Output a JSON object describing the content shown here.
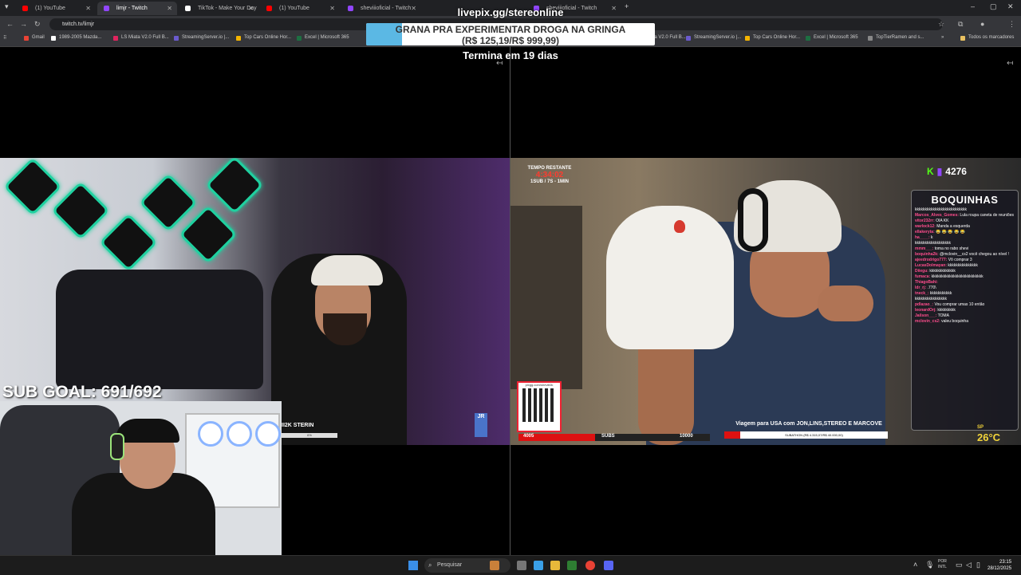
{
  "browser": {
    "tabs": [
      {
        "title": "(1) YouTube",
        "color": "#ff0000",
        "active": false
      },
      {
        "title": "limjr - Twitch",
        "color": "#9146ff",
        "active": true
      },
      {
        "title": "TikTok - Make Your Day",
        "color": "#ffffff",
        "active": false
      },
      {
        "title": "(1) YouTube",
        "color": "#ff0000",
        "active": false
      },
      {
        "title": "sheviiioficial - Twitch",
        "color": "#9146ff",
        "active": false
      },
      {
        "title": "sheviiioficial - Twitch",
        "color": "#9146ff",
        "active": false
      }
    ],
    "new_tab": "+",
    "url": "twitch.tv/limjr",
    "bookmarks": [
      {
        "label": "Gmail",
        "color": "#ea4335"
      },
      {
        "label": "1989-2005 Mazda...",
        "color": "#ffffff"
      },
      {
        "label": "LS Miata V2.0 Full B...",
        "color": "#e0245e"
      },
      {
        "label": "StreamingServer.io |...",
        "color": "#6a5acd"
      },
      {
        "label": "Top Cars Online Hor...",
        "color": "#f4b400"
      },
      {
        "label": "Excel | Microsoft 365",
        "color": "#1d6f42"
      },
      {
        "label": "LS Miata V2.0 Full B...",
        "color": "#e0245e"
      },
      {
        "label": "StreamingServer.io |...",
        "color": "#6a5acd"
      },
      {
        "label": "Top Cars Online Hor...",
        "color": "#f4b400"
      },
      {
        "label": "Excel | Microsoft 365",
        "color": "#1d6f42"
      },
      {
        "label": "TopTierRamen and s...",
        "color": "#888888"
      }
    ],
    "all_bookmarks": "Todos os marcadores"
  },
  "overlay": {
    "site": "livepix.gg/stereonline",
    "promo_line1": "GRANA PRA EXPERIMENTAR DROGA NA GRINGA",
    "promo_line2": "(R$ 125,19/R$ 999,99)",
    "promo_progress": 0.125,
    "timer": "Termina em 19 dias"
  },
  "left_stream": {
    "sub_goal": "SUB GOAL: 691/692",
    "tag": "II2K STERIN",
    "tag_pct": "6%",
    "logo": "JR"
  },
  "right_stream": {
    "timer_label": "TEMPO RESTANTE",
    "timer_value": "4:34:02",
    "timer_rule": "1SUB / 7S - 1MIN",
    "viewers": "4276",
    "chat_title": "BOQUINHAS",
    "chat": [
      {
        "user": "",
        "msg": "kkkkkkkkkkkkkkkkkkkkkkkkkk"
      },
      {
        "user": "Marcos_Alves_Gomes:",
        "msg": "Lula roupa caneta de reuniões quem dira nos kkkk"
      },
      {
        "user": "vitor232rr:",
        "msg": "OIA KK"
      },
      {
        "user": "warlock12:",
        "msg": "Manda a esquerda"
      },
      {
        "user": "ellakeryta:",
        "msg": "😂 😂 😂 😂 😂"
      },
      {
        "user": "ha____:",
        "msg": "k"
      },
      {
        "user": "",
        "msg": "kkkkkkkkkkkkkkkkkk"
      },
      {
        "user": "mmm___:",
        "msg": "toma no rabo shevi"
      },
      {
        "user": "boquinha2k:",
        "msg": "@mclovin__cs2 você chegou ao nível !"
      },
      {
        "user": "ajeedrodrigo777:",
        "msg": "Vô comprar 3"
      },
      {
        "user": "LucasDolmayan:",
        "msg": "kkkkkkkkkkkkkkk"
      },
      {
        "user": "Diiegu:",
        "msg": "kkkkkkkkkkkkk"
      },
      {
        "user": "fumaca:",
        "msg": "kkkkkkkkkkkkkkkkkkkkkkkkkk"
      },
      {
        "user": "ThiagoBahi:",
        "msg": ""
      },
      {
        "user": "ldr_rj:",
        "msg": ".770\\"
      },
      {
        "user": "tneck_:",
        "msg": "kkkkkkkkkkk"
      },
      {
        "user": "",
        "msg": "kkkkkkkkkkkkkkkk"
      },
      {
        "user": "pdlazao_:",
        "msg": "Vou comprar umas 10 então"
      },
      {
        "user": "leonardOrj:",
        "msg": "kkkkkkkkk"
      },
      {
        "user": "Jailson___:",
        "msg": "TOMA"
      },
      {
        "user": "mclovin_cs2:",
        "msg": "valeu boquinha"
      }
    ],
    "sp": "SP",
    "temp": "26°C",
    "qr_title": "pixgg.com/sheviii0k",
    "subs_current": "4005",
    "subs_label": "SUBS",
    "subs_goal": "10000",
    "subs_progress": 0.4,
    "usa_text": "Viagem para USA com JON,LINS,STEREO E MARCOVE",
    "subathon": "SUBATHON (R$ 4.315,07/R$ 40.000,00)"
  },
  "taskbar": {
    "search": "Pesquisar",
    "lang_top": "POR",
    "lang_bottom": "INTL",
    "time": "23:15",
    "date": "28/12/2025"
  }
}
